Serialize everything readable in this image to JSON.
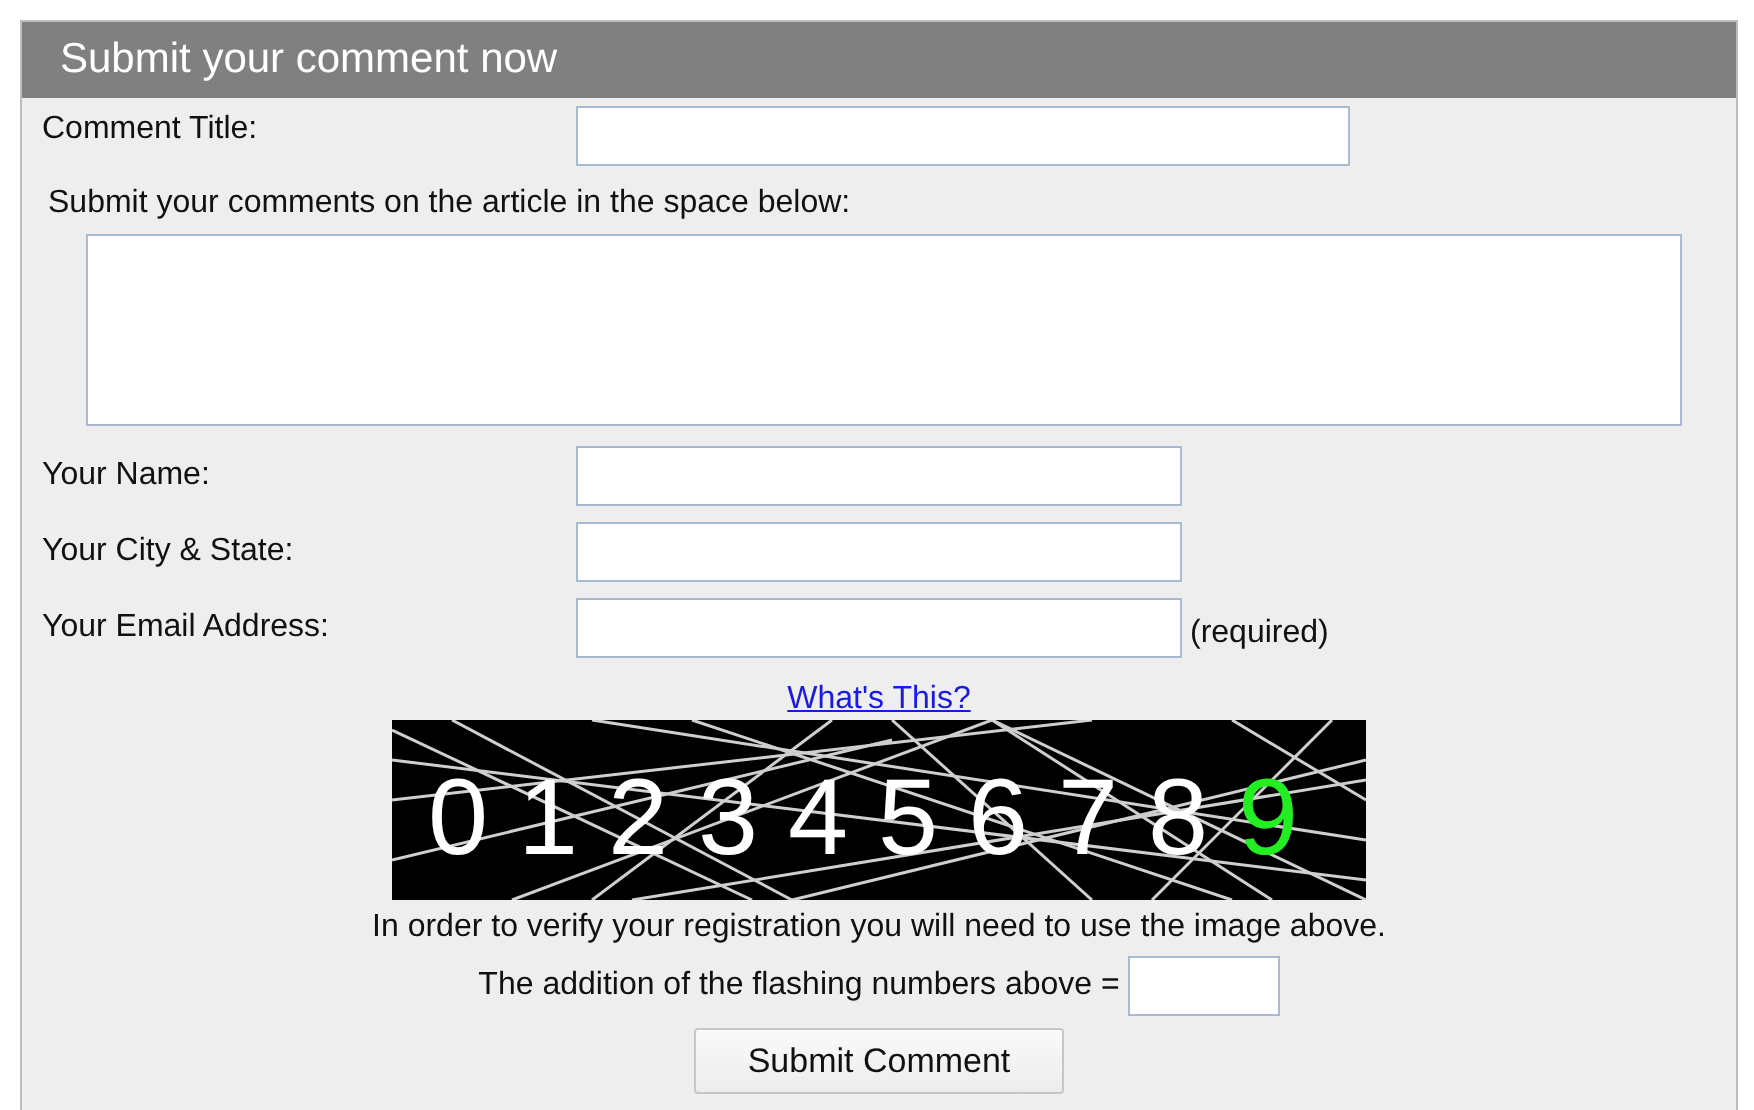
{
  "panel": {
    "title": "Submit your comment now"
  },
  "fields": [
    {
      "label": "Comment Title:",
      "kind": "wide"
    },
    {
      "label": "Submit your comments on the article in the space below:",
      "kind": "textarea"
    },
    {
      "label": "Your Name:",
      "kind": "short"
    },
    {
      "label": "Your City & State:",
      "kind": "short"
    },
    {
      "label": "Your Email Address:",
      "kind": "short",
      "note": "(required)"
    }
  ],
  "captcha": {
    "link": "What's This?",
    "digits": [
      {
        "text": "0",
        "highlighted": false
      },
      {
        "text": "1",
        "highlighted": false
      },
      {
        "text": "2",
        "highlighted": false
      },
      {
        "text": "3",
        "highlighted": false
      },
      {
        "text": "4",
        "highlighted": false
      },
      {
        "text": "5",
        "highlighted": false
      },
      {
        "text": "6",
        "highlighted": false
      },
      {
        "text": "7",
        "highlighted": false
      },
      {
        "text": "8",
        "highlighted": false
      },
      {
        "text": "9",
        "highlighted": true
      }
    ],
    "instruction": "In order to verify your registration you will need to use the image above.",
    "answer_label": "The addition of the flashing numbers above ="
  },
  "submit": "Submit Comment"
}
